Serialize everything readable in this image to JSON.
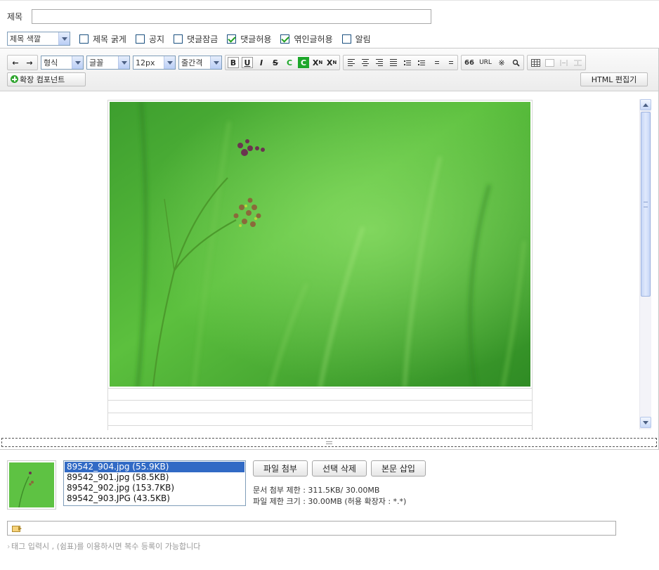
{
  "title_row": {
    "label": "제목",
    "value": "",
    "placeholder": ""
  },
  "options": {
    "title_color_select": "제목 색깔",
    "checkboxes": [
      {
        "label": "제목 굵게",
        "checked": false
      },
      {
        "label": "공지",
        "checked": false
      },
      {
        "label": "댓글잠금",
        "checked": false
      },
      {
        "label": "댓글허용",
        "checked": true
      },
      {
        "label": "엮인글허용",
        "checked": true
      },
      {
        "label": "알림",
        "checked": false
      }
    ]
  },
  "toolbar": {
    "format_select": "형식",
    "font_select": "글꼴",
    "size_select": "12px",
    "line_height_select": "줄간격",
    "buttons": {
      "undo": "←",
      "redo": "→",
      "bold": "B",
      "underline": "U",
      "italic": "I",
      "strike": "S",
      "font_color": "C",
      "bg_color": "C",
      "superscript": "X",
      "subscript": "X",
      "quote": "66",
      "url": "URL",
      "special_char": "※",
      "find": "🔍"
    },
    "extension_button": "확장 컴포넌트",
    "html_editor_button": "HTML 편집기"
  },
  "attachments": {
    "files": [
      {
        "name": "89542_904.jpg (55.9KB)",
        "selected": true
      },
      {
        "name": "89542_901.jpg (58.5KB)",
        "selected": false
      },
      {
        "name": "89542_902.jpg (153.7KB)",
        "selected": false
      },
      {
        "name": "89542_903.JPG (43.5KB)",
        "selected": false
      }
    ],
    "buttons": {
      "attach": "파일 첨부",
      "delete_selected": "선택 삭제",
      "insert_body": "본문 삽입"
    },
    "doc_limit": "문서 첨부 제한 : 311.5KB/ 30.00MB",
    "file_limit": "파일 제한 크기 : 30.00MB (허용 확장자 : *.*)"
  },
  "tags": {
    "value": "",
    "help": "태그 입력시 , (쉼표)를 이용하시면 복수 등록이 가능합니다"
  },
  "colors": {
    "checkbox_border": "#1c5180",
    "check_mark": "#21a121",
    "selection": "#316ac5",
    "photo_green": "#4fb838"
  }
}
